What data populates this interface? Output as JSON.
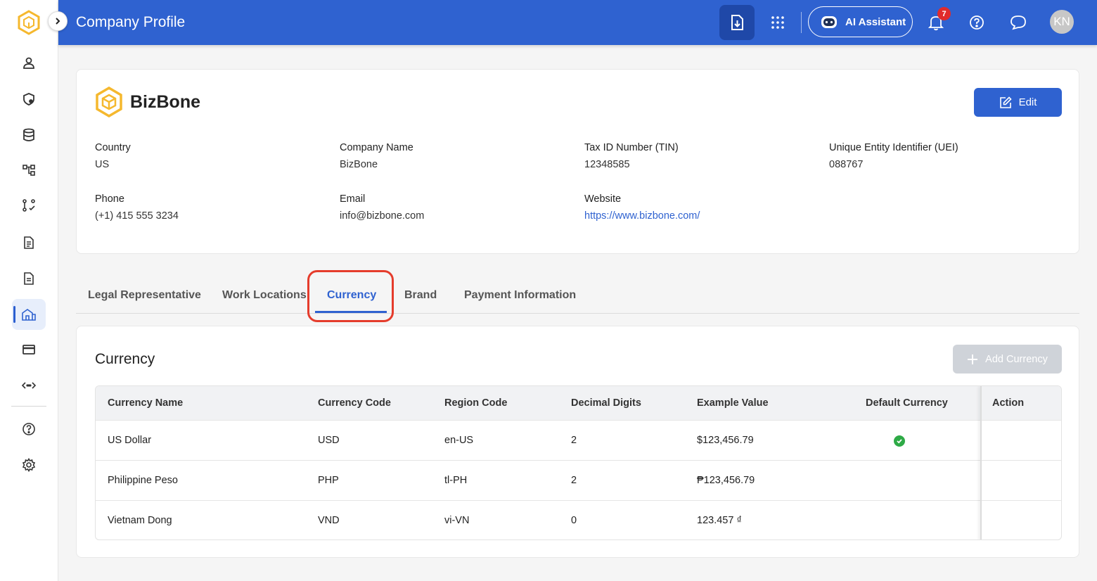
{
  "header": {
    "title": "Company Profile",
    "ai_assistant_label": "AI Assistant",
    "notification_count": "7",
    "avatar_initials": "KN"
  },
  "company": {
    "name": "BizBone",
    "edit_label": "Edit",
    "fields": {
      "country": {
        "label": "Country",
        "value": "US"
      },
      "company_name": {
        "label": "Company Name",
        "value": "BizBone"
      },
      "tin": {
        "label": "Tax ID Number (TIN)",
        "value": "12348585"
      },
      "uei": {
        "label": "Unique Entity Identifier (UEI)",
        "value": "088767"
      },
      "phone": {
        "label": "Phone",
        "value": "(+1) 415 555 3234"
      },
      "email": {
        "label": "Email",
        "value": "info@bizbone.com"
      },
      "website": {
        "label": "Website",
        "value": "https://www.bizbone.com/"
      }
    }
  },
  "tabs": [
    {
      "label": "Legal Representative"
    },
    {
      "label": "Work Locations"
    },
    {
      "label": "Currency"
    },
    {
      "label": "Brand"
    },
    {
      "label": "Payment Information"
    }
  ],
  "currency": {
    "title": "Currency",
    "add_label": "Add Currency",
    "columns": [
      "Currency Name",
      "Currency Code",
      "Region Code",
      "Decimal Digits",
      "Example Value",
      "Default Currency",
      "Action"
    ],
    "rows": [
      {
        "name": "US Dollar",
        "code": "USD",
        "region": "en-US",
        "digits": "2",
        "example": "$123,456.79",
        "default": true
      },
      {
        "name": "Philippine Peso",
        "code": "PHP",
        "region": "tl-PH",
        "digits": "2",
        "example": "₱123,456.79",
        "default": false
      },
      {
        "name": "Vietnam Dong",
        "code": "VND",
        "region": "vi-VN",
        "digits": "0",
        "example": "123.457 ₫",
        "default": false
      }
    ]
  },
  "colors": {
    "primary": "#2f62d0",
    "highlight": "#e53c2c",
    "success": "#2eaa46",
    "brand_yellow": "#f5b82e"
  }
}
